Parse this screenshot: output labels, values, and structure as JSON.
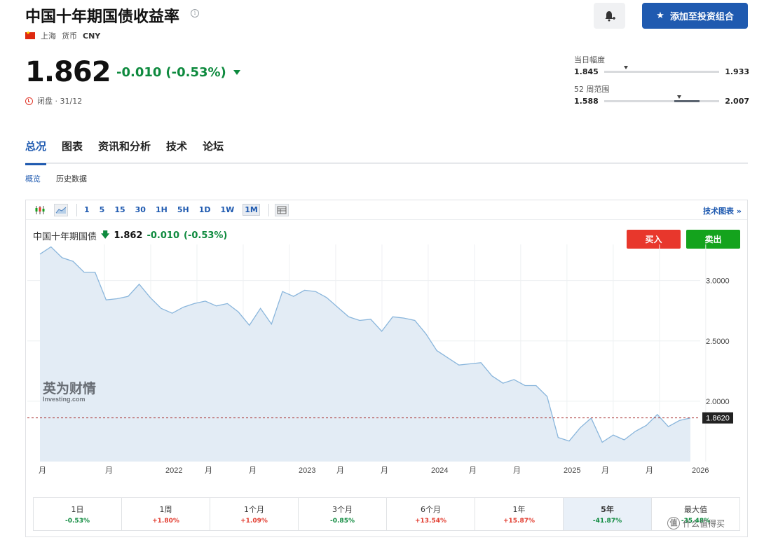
{
  "header": {
    "title": "中国十年期国债收益率",
    "location": "上海",
    "currency_label": "货币",
    "currency": "CNY",
    "add_portfolio_label": "添加至投资组合"
  },
  "quote": {
    "price": "1.862",
    "change": "-0.010",
    "change_pct": "(-0.53%)",
    "status": "闭盘 · 31/12"
  },
  "ranges": {
    "day": {
      "label": "当日幅度",
      "low": "1.845",
      "high": "1.933",
      "marker_fraction": 0.19
    },
    "week52": {
      "label": "52 周范围",
      "low": "1.588",
      "high": "2.007",
      "marker_fraction": 0.65,
      "fill_start": 0.61,
      "fill_end": 0.83
    }
  },
  "tabs": [
    "总况",
    "图表",
    "资讯和分析",
    "技术",
    "论坛"
  ],
  "subtabs": [
    "概览",
    "历史数据"
  ],
  "chart_toolbar": {
    "intervals": [
      "1",
      "5",
      "15",
      "30",
      "1H",
      "5H",
      "1D",
      "1W",
      "1M"
    ],
    "selected_interval": "1M",
    "tech_chart_label": "技术图表",
    "tech_chart_arrow": "»"
  },
  "chart_legend": {
    "name": "中国十年期国债",
    "arrow": "🡇",
    "value": "1.862",
    "change": "-0.010",
    "change_pct": "(-0.53%)"
  },
  "trade": {
    "buy": "买入",
    "sell": "卖出"
  },
  "watermark": {
    "cn": "英为财情",
    "en": "Investing.com"
  },
  "chart_data": {
    "type": "area",
    "x_tick_labels": [
      "月",
      "月",
      "2022",
      "月",
      "月",
      "2023",
      "月",
      "月",
      "2024",
      "月",
      "月",
      "2025",
      "月",
      "月",
      "2026"
    ],
    "y_ticks": [
      "3.0000",
      "2.5000",
      "2.0000"
    ],
    "y_range": [
      1.5,
      3.3
    ],
    "current_value_label": "1.8620",
    "current_value": 1.862,
    "values": [
      3.22,
      3.28,
      3.19,
      3.16,
      3.07,
      3.07,
      2.84,
      2.85,
      2.87,
      2.97,
      2.86,
      2.77,
      2.73,
      2.78,
      2.81,
      2.83,
      2.79,
      2.81,
      2.74,
      2.63,
      2.77,
      2.64,
      2.91,
      2.87,
      2.92,
      2.91,
      2.86,
      2.78,
      2.7,
      2.67,
      2.68,
      2.58,
      2.7,
      2.69,
      2.67,
      2.56,
      2.42,
      2.36,
      2.3,
      2.31,
      2.32,
      2.21,
      2.15,
      2.18,
      2.13,
      2.13,
      2.04,
      1.7,
      1.67,
      1.78,
      1.86,
      1.66,
      1.72,
      1.68,
      1.75,
      1.8,
      1.89,
      1.79,
      1.84,
      1.862
    ],
    "line_color": "#8ab6dc",
    "fill_color": "#e3ecf5",
    "grid": true
  },
  "performance": [
    {
      "period": "1日",
      "value": "-0.53%",
      "dir": "neg"
    },
    {
      "period": "1周",
      "value": "+1.80%",
      "dir": "pos"
    },
    {
      "period": "1个月",
      "value": "+1.09%",
      "dir": "pos"
    },
    {
      "period": "3个月",
      "value": "-0.85%",
      "dir": "neg"
    },
    {
      "period": "6个月",
      "value": "+13.54%",
      "dir": "pos"
    },
    {
      "period": "1年",
      "value": "+15.87%",
      "dir": "pos"
    },
    {
      "period": "5年",
      "value": "-41.87%",
      "dir": "neg",
      "selected": true
    },
    {
      "period": "最大值",
      "value": "-35.48%",
      "dir": "neg"
    }
  ],
  "corner_watermark": {
    "glyph": "值",
    "text": "什么值得买"
  },
  "colors": {
    "accent": "#1f5ab0",
    "down": "#0e8a3e",
    "up": "#e23b2e"
  }
}
